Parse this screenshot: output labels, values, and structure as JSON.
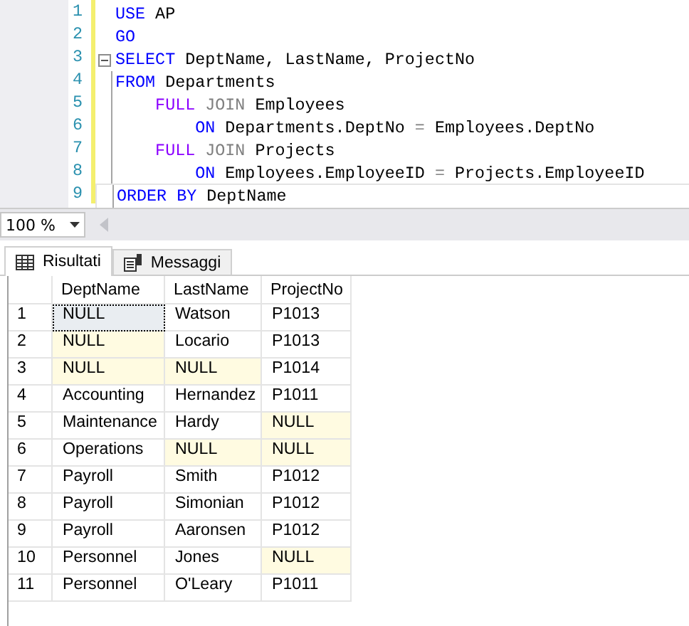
{
  "editor": {
    "lines": [
      {
        "number": "1",
        "foldable": false,
        "tokens": [
          {
            "text": "USE",
            "kind": "keyword"
          },
          {
            "text": " AP",
            "kind": "plain"
          }
        ]
      },
      {
        "number": "2",
        "foldable": false,
        "tokens": [
          {
            "text": "GO",
            "kind": "keyword"
          }
        ]
      },
      {
        "number": "3",
        "foldable": true,
        "tokens": [
          {
            "text": "SELECT",
            "kind": "keyword"
          },
          {
            "text": " DeptName, LastName, ProjectNo",
            "kind": "plain"
          }
        ]
      },
      {
        "number": "4",
        "foldable": false,
        "tokens": [
          {
            "text": "FROM",
            "kind": "keyword"
          },
          {
            "text": " Departments",
            "kind": "plain"
          }
        ]
      },
      {
        "number": "5",
        "foldable": false,
        "tokens": [
          {
            "text": "    FULL",
            "kind": "join"
          },
          {
            "text": " JOIN",
            "kind": "operator"
          },
          {
            "text": " Employees",
            "kind": "plain"
          }
        ]
      },
      {
        "number": "6",
        "foldable": false,
        "tokens": [
          {
            "text": "        ON",
            "kind": "keyword"
          },
          {
            "text": " Departments.DeptNo ",
            "kind": "plain"
          },
          {
            "text": "=",
            "kind": "operator"
          },
          {
            "text": " Employees.DeptNo",
            "kind": "plain"
          }
        ]
      },
      {
        "number": "7",
        "foldable": false,
        "tokens": [
          {
            "text": "    FULL",
            "kind": "join"
          },
          {
            "text": " JOIN",
            "kind": "operator"
          },
          {
            "text": " Projects",
            "kind": "plain"
          }
        ]
      },
      {
        "number": "8",
        "foldable": false,
        "tokens": [
          {
            "text": "        ON",
            "kind": "keyword"
          },
          {
            "text": " Employees.EmployeeID ",
            "kind": "plain"
          },
          {
            "text": "=",
            "kind": "operator"
          },
          {
            "text": " Projects.EmployeeID",
            "kind": "plain"
          }
        ]
      },
      {
        "number": "9",
        "foldable": false,
        "tokens": [
          {
            "text": "ORDER BY",
            "kind": "keyword"
          },
          {
            "text": " DeptName",
            "kind": "plain"
          }
        ]
      }
    ]
  },
  "zoom": {
    "value": "100 %"
  },
  "tabs": [
    {
      "label": "Risultati",
      "kind": "grid",
      "selected": true
    },
    {
      "label": "Messaggi",
      "kind": "messages",
      "selected": false
    }
  ],
  "table": {
    "columns": [
      "DeptName",
      "LastName",
      "ProjectNo"
    ],
    "rows": [
      {
        "number": "1",
        "cells": [
          {
            "text": "NULL",
            "null": true,
            "focused": true
          },
          {
            "text": "Watson",
            "null": false,
            "focused": false
          },
          {
            "text": "P1013",
            "null": false,
            "focused": false
          }
        ]
      },
      {
        "number": "2",
        "cells": [
          {
            "text": "NULL",
            "null": true,
            "focused": false
          },
          {
            "text": "Locario",
            "null": false,
            "focused": false
          },
          {
            "text": "P1013",
            "null": false,
            "focused": false
          }
        ]
      },
      {
        "number": "3",
        "cells": [
          {
            "text": "NULL",
            "null": true,
            "focused": false
          },
          {
            "text": "NULL",
            "null": true,
            "focused": false
          },
          {
            "text": "P1014",
            "null": false,
            "focused": false
          }
        ]
      },
      {
        "number": "4",
        "cells": [
          {
            "text": "Accounting",
            "null": false,
            "focused": false
          },
          {
            "text": "Hernandez",
            "null": false,
            "focused": false
          },
          {
            "text": "P1011",
            "null": false,
            "focused": false
          }
        ]
      },
      {
        "number": "5",
        "cells": [
          {
            "text": "Maintenance",
            "null": false,
            "focused": false
          },
          {
            "text": "Hardy",
            "null": false,
            "focused": false
          },
          {
            "text": "NULL",
            "null": true,
            "focused": false
          }
        ]
      },
      {
        "number": "6",
        "cells": [
          {
            "text": "Operations",
            "null": false,
            "focused": false
          },
          {
            "text": "NULL",
            "null": true,
            "focused": false
          },
          {
            "text": "NULL",
            "null": true,
            "focused": false
          }
        ]
      },
      {
        "number": "7",
        "cells": [
          {
            "text": "Payroll",
            "null": false,
            "focused": false
          },
          {
            "text": "Smith",
            "null": false,
            "focused": false
          },
          {
            "text": "P1012",
            "null": false,
            "focused": false
          }
        ]
      },
      {
        "number": "8",
        "cells": [
          {
            "text": "Payroll",
            "null": false,
            "focused": false
          },
          {
            "text": "Simonian",
            "null": false,
            "focused": false
          },
          {
            "text": "P1012",
            "null": false,
            "focused": false
          }
        ]
      },
      {
        "number": "9",
        "cells": [
          {
            "text": "Payroll",
            "null": false,
            "focused": false
          },
          {
            "text": "Aaronsen",
            "null": false,
            "focused": false
          },
          {
            "text": "P1012",
            "null": false,
            "focused": false
          }
        ]
      },
      {
        "number": "10",
        "cells": [
          {
            "text": "Personnel",
            "null": false,
            "focused": false
          },
          {
            "text": "Jones",
            "null": false,
            "focused": false
          },
          {
            "text": "NULL",
            "null": true,
            "focused": false
          }
        ]
      },
      {
        "number": "11",
        "cells": [
          {
            "text": "Personnel",
            "null": false,
            "focused": false
          },
          {
            "text": "O'Leary",
            "null": false,
            "focused": false
          },
          {
            "text": "P1011",
            "null": false,
            "focused": false
          }
        ]
      }
    ]
  }
}
